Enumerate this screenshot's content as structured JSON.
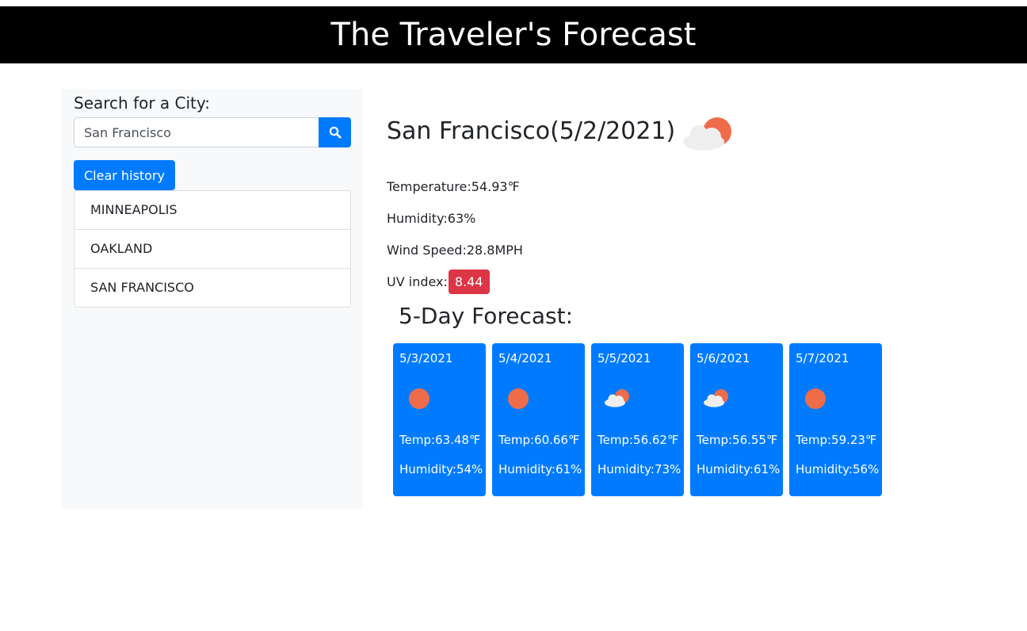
{
  "header": {
    "title": "The Traveler's Forecast"
  },
  "sidebar": {
    "search_label": "Search for a City:",
    "search_value": "San Francisco",
    "search_icon": "search-icon",
    "clear_label": "Clear history",
    "history": [
      "MINNEAPOLIS",
      "OAKLAND",
      "SAN FRANCISCO"
    ]
  },
  "current": {
    "title": "San Francisco(5/2/2021)",
    "icon": "partly-cloudy-icon",
    "temperature": "Temperature:54.93℉",
    "humidity": "Humidity:63%",
    "wind": "Wind Speed:28.8MPH",
    "uv_label": "UV index:",
    "uv_value": "8.44"
  },
  "forecast": {
    "title": "5-Day Forecast:",
    "days": [
      {
        "date": "5/3/2021",
        "icon": "sun-icon",
        "temp": "Temp:63.48℉",
        "humidity": "Humidity:54%"
      },
      {
        "date": "5/4/2021",
        "icon": "sun-icon",
        "temp": "Temp:60.66℉",
        "humidity": "Humidity:61%"
      },
      {
        "date": "5/5/2021",
        "icon": "partly-cloudy-icon",
        "temp": "Temp:56.62℉",
        "humidity": "Humidity:73%"
      },
      {
        "date": "5/6/2021",
        "icon": "partly-cloudy-icon",
        "temp": "Temp:56.55℉",
        "humidity": "Humidity:61%"
      },
      {
        "date": "5/7/2021",
        "icon": "sun-icon",
        "temp": "Temp:59.23℉",
        "humidity": "Humidity:56%"
      }
    ]
  },
  "colors": {
    "primary": "#007bff",
    "danger": "#dc3545",
    "header_bg": "#000000",
    "sidebar_bg": "#f8f9fa",
    "sun": "#ef6c4a",
    "cloud": "#eeeeee"
  }
}
